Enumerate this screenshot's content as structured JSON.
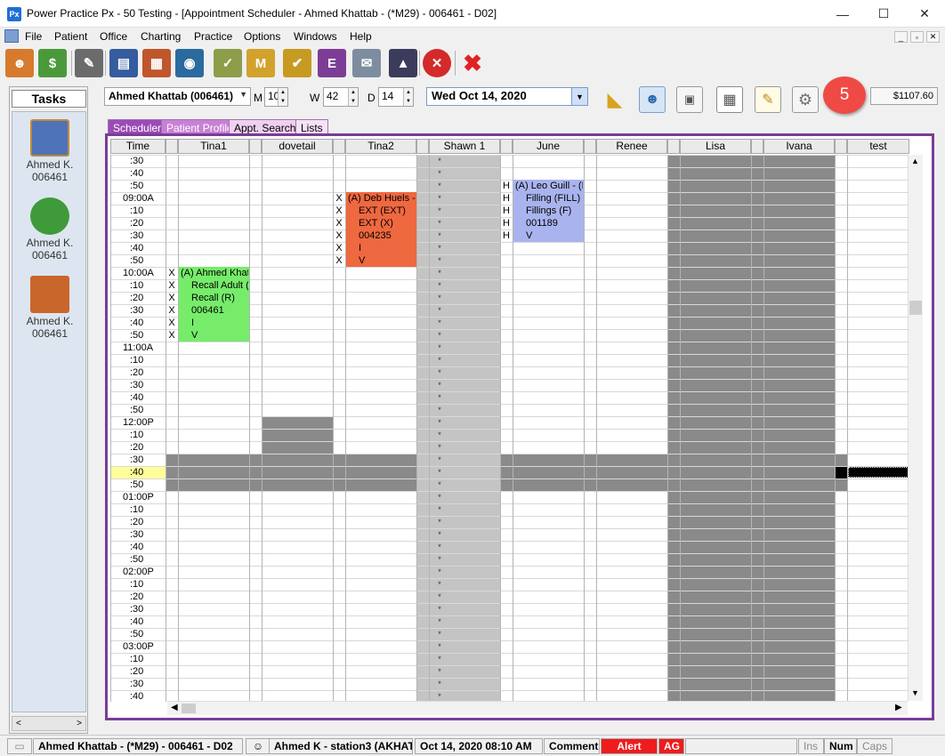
{
  "window": {
    "app_icon": "Px",
    "title": "Power Practice Px - 50 Testing - [Appointment Scheduler - Ahmed Khattab - (*M29) - 006461 - D02]",
    "minimize": "—",
    "maximize": "☐",
    "close": "✕"
  },
  "menu": {
    "items": [
      "File",
      "Patient",
      "Office",
      "Charting",
      "Practice",
      "Options",
      "Windows",
      "Help"
    ],
    "mdi_min": "_",
    "mdi_restore": "▫",
    "mdi_close": "✕"
  },
  "toolbar": {
    "buttons": [
      {
        "icon": "patient-icon",
        "glyph": "☻",
        "color": "#d77a2b"
      },
      {
        "icon": "billing-icon",
        "glyph": "$",
        "color": "#4a9a3c"
      },
      {
        "icon": "edit-icon",
        "glyph": "✎",
        "color": "#6b6b6b"
      },
      {
        "icon": "book-icon",
        "glyph": "▤",
        "color": "#355c9e"
      },
      {
        "icon": "chart-icon",
        "glyph": "▦",
        "color": "#c0562c"
      },
      {
        "icon": "xray-icon",
        "glyph": "◉",
        "color": "#2b6a9e"
      },
      {
        "icon": "notes-icon",
        "glyph": "✓",
        "color": "#8c9e49"
      },
      {
        "icon": "memo-icon",
        "glyph": "M",
        "color": "#d2a22c"
      },
      {
        "icon": "tasks-icon",
        "glyph": "✔",
        "color": "#c79a22"
      },
      {
        "icon": "edi-icon",
        "glyph": "E",
        "color": "#7d3d96"
      },
      {
        "icon": "mail-icon",
        "glyph": "✉",
        "color": "#7d8da0"
      },
      {
        "icon": "education-icon",
        "glyph": "▲",
        "color": "#3b3b5c"
      },
      {
        "icon": "cancel-circle-icon",
        "glyph": "✕",
        "color": "#d32a2a"
      },
      {
        "icon": "close-x-icon",
        "glyph": "✖",
        "color": "#e02222"
      }
    ]
  },
  "tasks": {
    "title": "Tasks",
    "items": [
      {
        "icon": "appointment-book-icon",
        "name": "Ahmed K.",
        "id": "006461",
        "color": "#4f73b8"
      },
      {
        "icon": "billing-icon",
        "name": "Ahmed K.",
        "id": "006461",
        "color": "#3f9a3a"
      },
      {
        "icon": "chart-icon",
        "name": "Ahmed K.",
        "id": "006461",
        "color": "#c9662c"
      }
    ],
    "scroll_left": "<",
    "scroll_right": ">"
  },
  "header": {
    "patient": "Ahmed Khattab (006461)",
    "m_label": "M",
    "m_value": "10",
    "w_label": "W",
    "w_value": "42",
    "d_label": "D",
    "d_value": "14",
    "date": "Wed  Oct 14, 2020",
    "badge": "5",
    "balance": "$1107.60"
  },
  "tabs": [
    "Scheduler",
    "Patient Profile",
    "Appt. Search",
    "Lists"
  ],
  "scheduler": {
    "columns": [
      "Time",
      "Tina1",
      "dovetail",
      "Tina2",
      "Shawn 1",
      "June",
      "Renee",
      "Lisa",
      "Ivana",
      "test"
    ],
    "times": [
      ":30",
      ":40",
      ":50",
      "09:00A",
      ":10",
      ":20",
      ":30",
      ":40",
      ":50",
      "10:00A",
      ":10",
      ":20",
      ":30",
      ":40",
      ":50",
      "11:00A",
      ":10",
      ":20",
      ":30",
      ":40",
      ":50",
      "12:00P",
      ":10",
      ":20",
      ":30",
      ":40",
      ":50",
      "01:00P",
      ":10",
      ":20",
      ":30",
      ":40",
      ":50",
      "02:00P",
      ":10",
      ":20",
      ":30",
      ":40",
      ":50",
      "03:00P",
      ":10",
      ":20",
      ":30",
      ":40"
    ],
    "star": "*",
    "appointments": [
      {
        "provider": "Tina2",
        "mark": "X",
        "color": "#ee6840",
        "lines": [
          "(A) Deb Huels -",
          "EXT (EXT)",
          "EXT (X)",
          "004235",
          "I",
          "V"
        ]
      },
      {
        "provider": "June",
        "mark": "H",
        "color": "#a9b4ee",
        "lines": [
          "(A) Leo Guill - (H",
          "Filling (FILL)",
          "Fillings (F)",
          "001189",
          "V"
        ]
      },
      {
        "provider": "Tina1",
        "mark": "X",
        "color": "#76ec6a",
        "lines": [
          "(A) Ahmed Khat",
          "Recall Adult (",
          "Recall (R)",
          "006461",
          "I",
          "V"
        ]
      }
    ]
  },
  "statusbar": {
    "patient": "Ahmed Khattab - (*M29) - 006461 - D02",
    "station": "Ahmed K - station3 (AKHAT",
    "datetime": "Oct 14, 2020 08:10 AM",
    "comment": "Comment",
    "alert": "Alert",
    "ag": "AG",
    "ins": "Ins",
    "num": "Num",
    "caps": "Caps",
    "alert_color": "#ee1c1c"
  }
}
